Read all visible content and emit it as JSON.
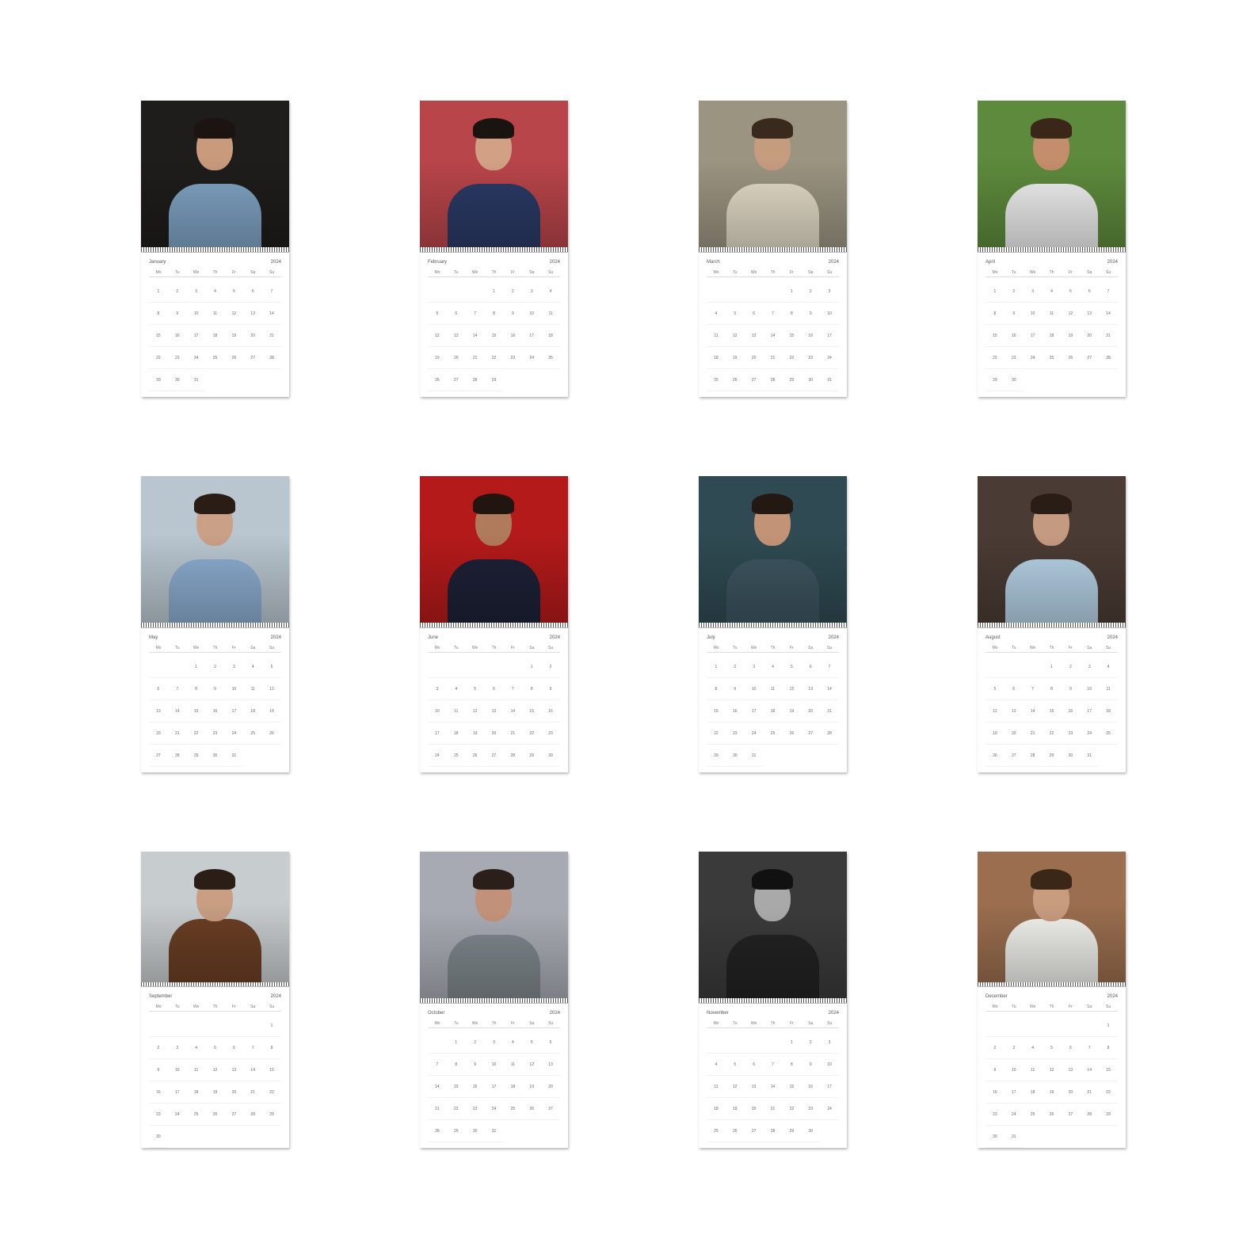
{
  "year": "2024",
  "weekdays": [
    "Mo",
    "Tu",
    "We",
    "Th",
    "Fr",
    "Sa",
    "Su"
  ],
  "months": [
    {
      "name": "January",
      "days": 31,
      "offset": 0,
      "photo": {
        "bg": "#1f1d1b",
        "skin": "#c99a7c",
        "hair": "#1b1410",
        "cloth": "#7fa3c4"
      }
    },
    {
      "name": "February",
      "days": 29,
      "offset": 3,
      "photo": {
        "bg": "#b8454a",
        "skin": "#d2a185",
        "hair": "#1a1411",
        "cloth": "#2b3a66"
      }
    },
    {
      "name": "March",
      "days": 31,
      "offset": 4,
      "photo": {
        "bg": "#9b9481",
        "skin": "#c69c7f",
        "hair": "#3a2a1e",
        "cloth": "#e4dcc8"
      }
    },
    {
      "name": "April",
      "days": 30,
      "offset": 0,
      "photo": {
        "bg": "#5d8a3c",
        "skin": "#c48d6c",
        "hair": "#3b2719",
        "cloth": "#efefef"
      }
    },
    {
      "name": "May",
      "days": 31,
      "offset": 2,
      "photo": {
        "bg": "#b9c6cf",
        "skin": "#caa086",
        "hair": "#2a1d16",
        "cloth": "#8cadd0"
      }
    },
    {
      "name": "June",
      "days": 30,
      "offset": 5,
      "photo": {
        "bg": "#b41a1a",
        "skin": "#b07a5c",
        "hair": "#20150f",
        "cloth": "#1d2136"
      }
    },
    {
      "name": "July",
      "days": 31,
      "offset": 0,
      "photo": {
        "bg": "#2f4a52",
        "skin": "#c39377",
        "hair": "#231812",
        "cloth": "#3d5560"
      }
    },
    {
      "name": "August",
      "days": 31,
      "offset": 3,
      "photo": {
        "bg": "#4a3b34",
        "skin": "#c49a80",
        "hair": "#2a1d16",
        "cloth": "#b6d2e6"
      }
    },
    {
      "name": "September",
      "days": 30,
      "offset": 6,
      "photo": {
        "bg": "#c7ccce",
        "skin": "#c99e82",
        "hair": "#2a1e17",
        "cloth": "#6b3f24"
      }
    },
    {
      "name": "October",
      "days": 31,
      "offset": 1,
      "photo": {
        "bg": "#a8aab3",
        "skin": "#c2917a",
        "hair": "#2b1f19",
        "cloth": "#7f878c"
      }
    },
    {
      "name": "November",
      "days": 30,
      "offset": 4,
      "photo": {
        "bg": "#3a3a3a",
        "skin": "#a9a9a9",
        "hair": "#111111",
        "cloth": "#222222"
      }
    },
    {
      "name": "December",
      "days": 31,
      "offset": 6,
      "photo": {
        "bg": "#9a6e4e",
        "skin": "#c89c7f",
        "hair": "#3a2718",
        "cloth": "#f2f2ee"
      }
    }
  ]
}
